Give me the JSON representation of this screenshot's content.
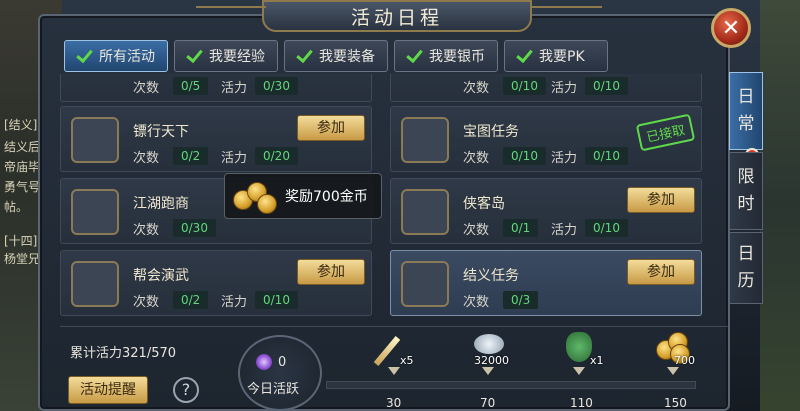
{
  "title": "活动日程",
  "tabs": [
    {
      "label": "所有活动",
      "active": true
    },
    {
      "label": "我要经验",
      "active": false
    },
    {
      "label": "我要装备",
      "active": false
    },
    {
      "label": "我要银币",
      "active": false
    },
    {
      "label": "我要PK",
      "active": false
    }
  ],
  "stat_labels": {
    "count": "次数",
    "vitality": "活力"
  },
  "activities": [
    {
      "name": "",
      "count": "0/5",
      "vitality": "0/30",
      "icon": "silver-ingot-icon"
    },
    {
      "name": "",
      "count": "0/10",
      "vitality": "0/10",
      "icon": "scroll-icon"
    },
    {
      "name": "镖行天下",
      "count": "0/2",
      "vitality": "0/20",
      "action": "参加",
      "icon": "silver-ingot-icon"
    },
    {
      "name": "宝图任务",
      "count": "0/10",
      "vitality": "0/10",
      "badge": "已接取",
      "icon": "treasure-map-icon"
    },
    {
      "name": "江湖跑商",
      "count": "0/30",
      "vitality": "",
      "icon": "silver-ingot-icon"
    },
    {
      "name": "侠客岛",
      "count": "0/1",
      "vitality": "0/10",
      "action": "参加",
      "icon": "scroll-icon"
    },
    {
      "name": "帮会演武",
      "count": "0/2",
      "vitality": "0/10",
      "action": "参加",
      "icon": "crystal-icon"
    },
    {
      "name": "结义任务",
      "count": "0/3",
      "vitality": "",
      "action": "参加",
      "icon": "scroll-icon"
    }
  ],
  "tooltip": {
    "text": "奖励700金币"
  },
  "accumulated": "累计活力321/570",
  "remind_button": "活动提醒",
  "help_symbol": "?",
  "today": {
    "value": "0",
    "label": "今日活跃"
  },
  "rewards": [
    {
      "qty": "x5",
      "threshold": "30",
      "icon": "sword-icon"
    },
    {
      "qty": "32000",
      "threshold": "70",
      "icon": "silver-ingot-icon"
    },
    {
      "qty": "x1",
      "threshold": "110",
      "icon": "money-bag-icon"
    },
    {
      "qty": "700",
      "threshold": "150",
      "icon": "gold-coin-icon"
    }
  ],
  "side_tabs": [
    {
      "chars": [
        "日",
        "常"
      ],
      "active": true
    },
    {
      "chars": [
        "限",
        "时"
      ],
      "active": false
    },
    {
      "chars": [
        "日",
        "历"
      ],
      "active": false
    }
  ],
  "background_text": [
    "[结义]",
    "结义后",
    "帝庙毕",
    "勇气号",
    "帖。",
    "[十四]",
    "杨堂兄"
  ],
  "colors": {
    "accent": "#3b6ea5",
    "value_green": "#62d67b",
    "button_gold": "#e2c06f"
  }
}
